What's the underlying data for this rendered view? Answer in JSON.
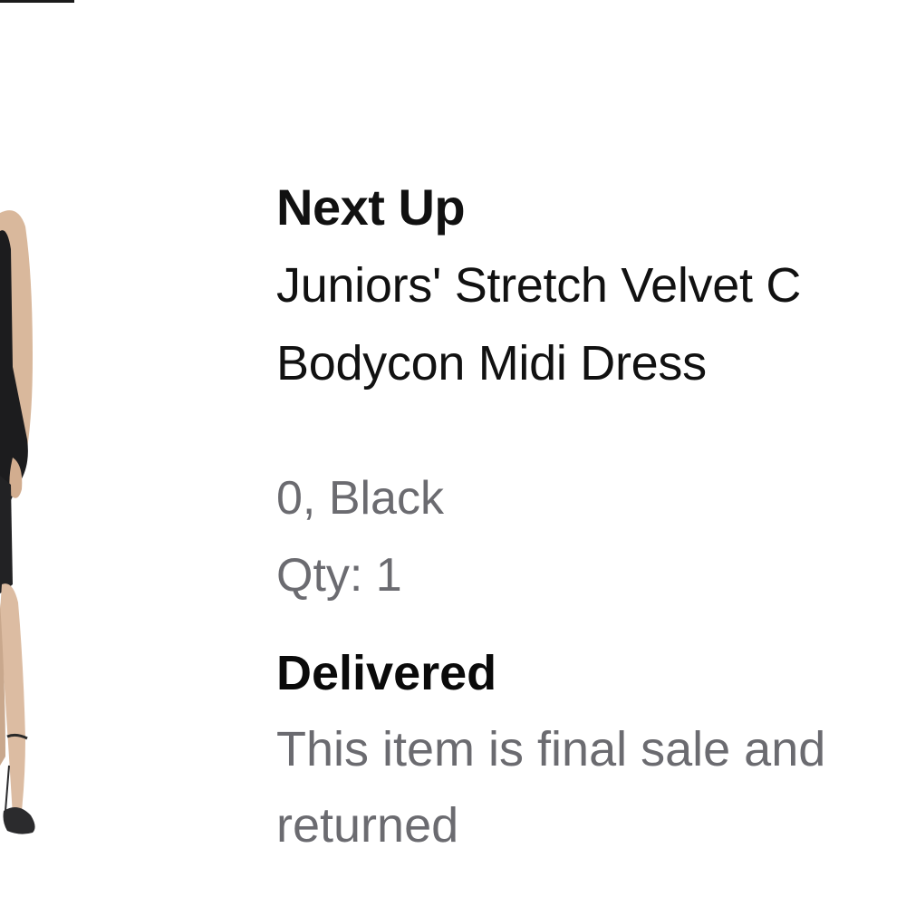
{
  "order_item": {
    "brand": "Next Up",
    "product_name_line1": "Juniors' Stretch Velvet C",
    "product_name_line2": "Bodycon Midi Dress",
    "variant": "0, Black",
    "quantity": "Qty: 1",
    "status": "Delivered",
    "note_line1": "This item is final sale and",
    "note_line2": "returned",
    "image_icon": "product-photo-dress-model"
  },
  "colors": {
    "primary_text": "#111111",
    "secondary_text": "#6b6b70",
    "background": "#ffffff"
  }
}
